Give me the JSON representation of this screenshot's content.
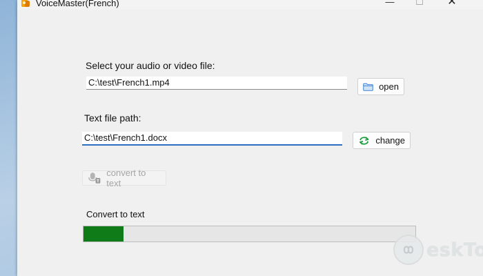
{
  "window": {
    "title": "VoiceMaster(French)",
    "controls": {
      "minimize": "—",
      "maximize": "☐",
      "close": "✕"
    }
  },
  "audio": {
    "label": "Select your audio or video file:",
    "path_value": "C:\\test\\French1.mp4",
    "open_label": "open",
    "open_icon": "folder-icon"
  },
  "text_file": {
    "label": "Text file path:",
    "path_value": "C:\\test\\French1.docx",
    "change_label": "change",
    "change_icon": "refresh-arrows-icon"
  },
  "convert": {
    "button_label": "convert to text",
    "button_icon": "microphone-icon",
    "enabled": false
  },
  "progress": {
    "label": "Convert to text",
    "fraction": 0.12,
    "fill_color": "#0f7a18"
  },
  "watermark": {
    "text": "eskTop"
  }
}
